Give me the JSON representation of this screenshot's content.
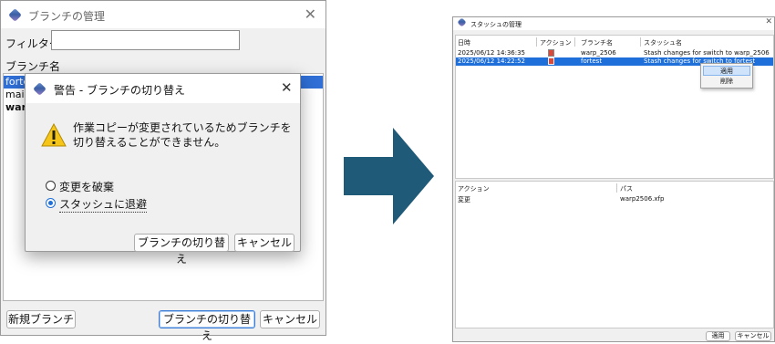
{
  "left_window": {
    "title": "ブランチの管理",
    "filter_label": "フィルター:",
    "filter_value": "",
    "column_header": "ブランチ名",
    "branches": [
      "fortest",
      "main",
      "warp"
    ],
    "new_branch_button": "新規ブランチ",
    "switch_button": "ブランチの切り替え",
    "cancel_button": "キャンセル"
  },
  "dialog": {
    "title": "警告 - ブランチの切り替え",
    "message_line1": "作業コピーが変更されているためブランチを",
    "message_line2": "切り替えることができません。",
    "option_discard": "変更を破棄",
    "option_stash": "スタッシュに退避",
    "selected_option": "option_stash",
    "switch_button": "ブランチの切り替え",
    "cancel_button": "キャンセル"
  },
  "arrow_color": "#1f5a78",
  "right_window": {
    "title": "スタッシュの管理",
    "columns": [
      "日時",
      "アクション",
      "ブランチ名",
      "スタッシュ名"
    ],
    "stashes": [
      {
        "date": "2025/06/12 14:36:35",
        "branch": "warp_2506",
        "name": "Stash changes for switch to warp_2506",
        "selected": false
      },
      {
        "date": "2025/06/12 14:22:52",
        "branch": "fortest",
        "name": "Stash changes for switch to fortest",
        "selected": true
      }
    ],
    "context_menu": [
      "適用",
      "削除"
    ],
    "lower_columns": [
      "アクション",
      "パス"
    ],
    "changes": [
      {
        "action": "変更",
        "path": "warp2506.xfp"
      }
    ],
    "apply_button": "適用",
    "cancel_button": "キャンセル"
  }
}
